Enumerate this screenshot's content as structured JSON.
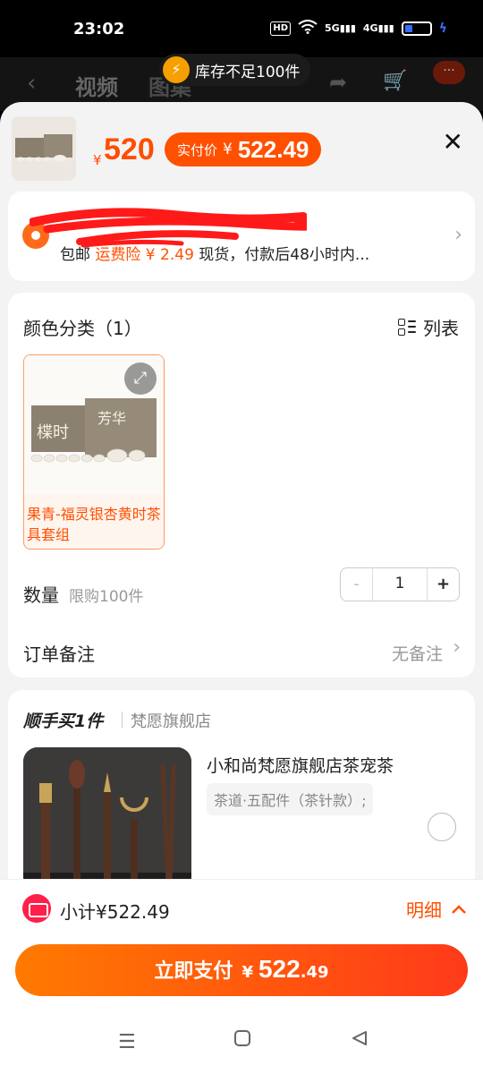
{
  "status_bar": {
    "time": "23:02",
    "hd": "HD",
    "net1": "5G",
    "net2": "4G"
  },
  "background_header": {
    "tab_video": "视频",
    "tab_image": "图集",
    "more": "···"
  },
  "toast": {
    "icon": "⚡",
    "text": "库存不足100件"
  },
  "product": {
    "price_symbol": "¥",
    "price": "520",
    "actual_label": "实付价",
    "actual_symbol": "¥",
    "actual_price": "522.49"
  },
  "shipping": {
    "free_shipping": "包邮",
    "insurance": "运费险 ¥ 2.49",
    "delivery": "现货，付款后48小时内..."
  },
  "spec": {
    "title": "颜色分类（1）",
    "list_label": "列表",
    "variant_label": "果青-福灵银杏黄时茶具套组"
  },
  "quantity": {
    "label": "数量",
    "limit": "限购100件",
    "minus": "-",
    "value": "1",
    "plus": "+"
  },
  "note": {
    "label": "订单备注",
    "value": "无备注"
  },
  "addon": {
    "title": "顺手买1件",
    "shop": "梵愿旗舰店",
    "name": "小和尚梵愿旗舰店茶宠茶",
    "spec": "茶道·五配件（茶针款）;"
  },
  "bottom": {
    "subtotal": "小计¥522.49",
    "detail": "明细",
    "pay_label": "立即支付",
    "pay_symbol": "¥",
    "pay_int": "522",
    "pay_dec": ".49"
  },
  "colors": {
    "accent": "#ff5000",
    "accent_light": "#fff5ef",
    "danger": "#ff1f48"
  },
  "icons": [
    "close-icon",
    "location-icon",
    "chevron-right-icon",
    "list-grid-icon",
    "expand-icon",
    "coupon-icon",
    "chevron-up-icon",
    "menu-icon",
    "home-icon",
    "back-icon"
  ]
}
